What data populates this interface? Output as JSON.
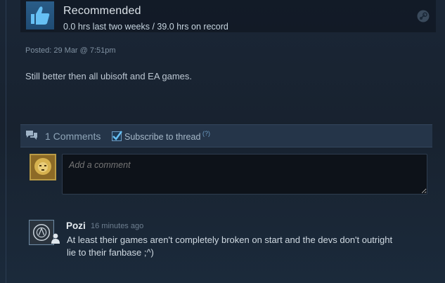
{
  "review": {
    "verdict": "Recommended",
    "hours": "0.0 hrs last two weeks / 39.0 hrs on record",
    "posted": "Posted: 29 Mar @ 7:51pm",
    "body": "Still better then all ubisoft and EA games."
  },
  "comments_bar": {
    "count_label": "1 Comments",
    "subscribe_label": "Subscribe to thread",
    "subscribed": true,
    "help": "(?)"
  },
  "add_comment": {
    "placeholder": "Add a comment"
  },
  "comments": [
    {
      "author": "Pozi",
      "time": "16 minutes ago",
      "text": "At least their games aren't completely broken on start and the devs don't outright lie to their fanbase ;^)"
    }
  ],
  "icons": {
    "verdict": "thumbs-up-icon",
    "platform": "steam-icon",
    "comments": "speech-bubbles-icon",
    "friend": "person-icon"
  },
  "colors": {
    "background": "#1b2838",
    "accent": "#6c9bc2",
    "thumb_tile": "#2a5d88"
  }
}
